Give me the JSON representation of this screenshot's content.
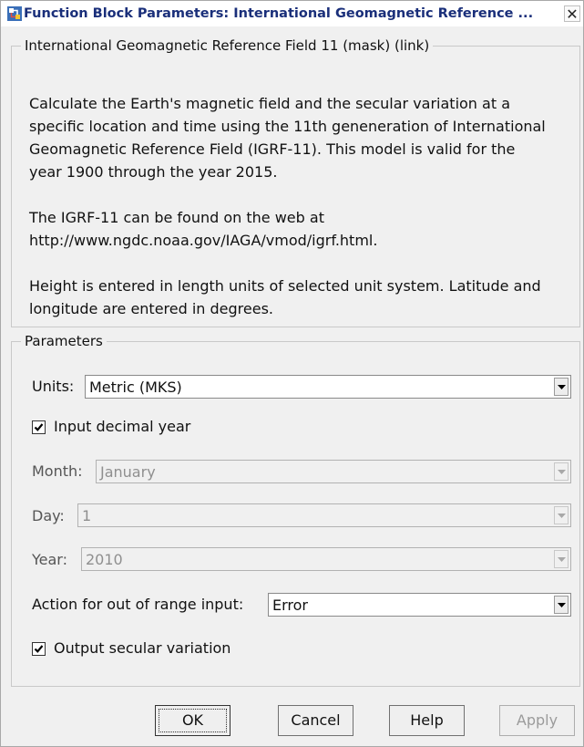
{
  "window": {
    "title": "Function Block Parameters: International Geomagnetic Reference ...",
    "close_label": "✕"
  },
  "description_group": {
    "legend": "International Geomagnetic Reference Field 11 (mask) (link)",
    "paragraphs": [
      [
        "Calculate the Earth's magnetic field and the secular variation at a",
        "specific location and time using the 11th geneneration of International",
        "Geomagnetic Reference Field (IGRF-11).  This model is valid for the",
        "year 1900 through the year 2015."
      ],
      [
        "The IGRF-11 can be found on the web at",
        "http://www.ngdc.noaa.gov/IAGA/vmod/igrf.html."
      ],
      [
        "Height is entered in length units of selected unit system. Latitude and",
        "longitude are entered in degrees."
      ]
    ]
  },
  "parameters_group": {
    "legend": "Parameters",
    "units": {
      "label": "Units:",
      "value": "Metric (MKS)"
    },
    "input_decimal_year": {
      "label": "Input decimal year",
      "checked": true
    },
    "month": {
      "label": "Month:",
      "value": "January",
      "enabled": false
    },
    "day": {
      "label": "Day:",
      "value": "1",
      "enabled": false
    },
    "year": {
      "label": "Year:",
      "value": "2010",
      "enabled": false
    },
    "out_of_range": {
      "label": "Action for out of range input:",
      "value": "Error"
    },
    "output_secular_variation": {
      "label": "Output secular variation",
      "checked": true
    }
  },
  "buttons": {
    "ok": "OK",
    "cancel": "Cancel",
    "help": "Help",
    "apply": "Apply"
  },
  "colors": {
    "title_text": "#1a2f7a",
    "window_bg": "#f0f0f0",
    "disabled_text": "#8f8f8f"
  }
}
